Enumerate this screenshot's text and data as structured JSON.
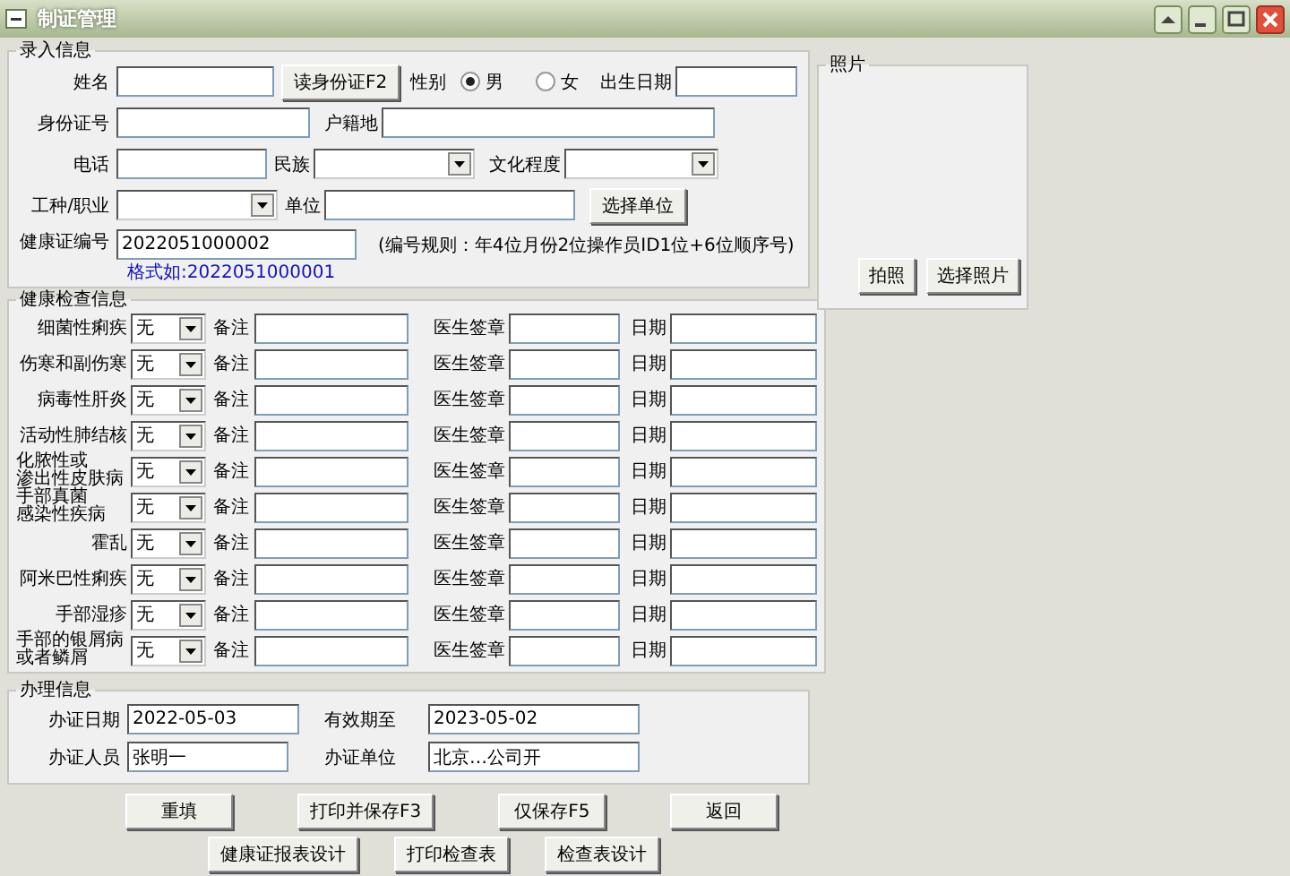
{
  "window": {
    "title": "制证管理"
  },
  "entry": {
    "legend": "录入信息",
    "name_label": "姓名",
    "read_id_button": "读身份证F2",
    "gender": {
      "label": "性别",
      "options": [
        {
          "label": "男",
          "selected": true
        },
        {
          "label": "女",
          "selected": false
        }
      ]
    },
    "birth_label": "出生日期",
    "id_label": "身份证号",
    "domicile_label": "户籍地",
    "phone_label": "电话",
    "ethnicity_label": "民族",
    "education_label": "文化程度",
    "occupation_label": "工种/职业",
    "unit_label": "单位",
    "select_unit_button": "选择单位",
    "cert_no": {
      "label": "健康证编号",
      "value": "2022051000002",
      "hint": "格式如:2022051000001",
      "rule": "(编号规则：年4位月份2位操作员ID1位+6位顺序号)"
    }
  },
  "photo": {
    "legend": "照片",
    "buttons": [
      "拍照",
      "选择照片"
    ]
  },
  "checks": {
    "legend": "健康检查信息",
    "rows": [
      {
        "disease": "细菌性痢疾",
        "result": "无",
        "remark_label": "备注",
        "doctor_label": "医生签章",
        "date_label": "日期"
      },
      {
        "disease": "伤寒和副伤寒",
        "result": "无",
        "remark_label": "备注",
        "doctor_label": "医生签章",
        "date_label": "日期"
      },
      {
        "disease": "病毒性肝炎",
        "result": "无",
        "remark_label": "备注",
        "doctor_label": "医生签章",
        "date_label": "日期"
      },
      {
        "disease": "活动性肺结核",
        "result": "无",
        "remark_label": "备注",
        "doctor_label": "医生签章",
        "date_label": "日期"
      },
      {
        "disease": [
          "化脓性或",
          "渗出性皮肤病"
        ],
        "result": "无",
        "remark_label": "备注",
        "doctor_label": "医生签章",
        "date_label": "日期"
      },
      {
        "disease": [
          "手部真菌",
          "感染性疾病"
        ],
        "result": "无",
        "remark_label": "备注",
        "doctor_label": "医生签章",
        "date_label": "日期"
      },
      {
        "disease": "霍乱",
        "result": "无",
        "remark_label": "备注",
        "doctor_label": "医生签章",
        "date_label": "日期"
      },
      {
        "disease": "阿米巴性痢疾",
        "result": "无",
        "remark_label": "备注",
        "doctor_label": "医生签章",
        "date_label": "日期"
      },
      {
        "disease": "手部湿疹",
        "result": "无",
        "remark_label": "备注",
        "doctor_label": "医生签章",
        "date_label": "日期"
      },
      {
        "disease": [
          "手部的银屑病",
          "或者鳞屑"
        ],
        "result": "无",
        "remark_label": "备注",
        "doctor_label": "医生签章",
        "date_label": "日期"
      }
    ]
  },
  "processing": {
    "legend": "办理信息",
    "issue_date": {
      "label": "办证日期",
      "value": "2022-05-03"
    },
    "valid_until": {
      "label": "有效期至",
      "value": "2023-05-02"
    },
    "issuer": {
      "label": "办证人员",
      "value": "张明一"
    },
    "issuing_unit": {
      "label": "办证单位",
      "value": "北京…公司开"
    }
  },
  "buttons": [
    [
      "重填",
      "打印并保存F3",
      "仅保存F5",
      "返回"
    ],
    [
      "健康证报表设计",
      "打印检查表",
      "检查表设计"
    ]
  ]
}
